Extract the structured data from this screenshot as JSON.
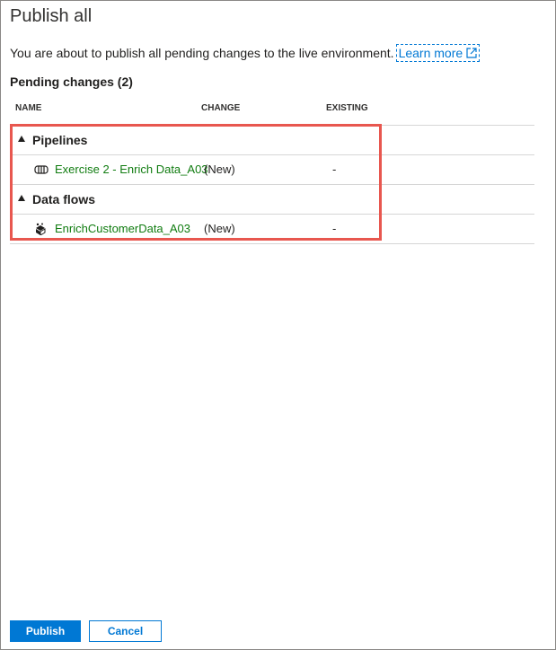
{
  "dialog": {
    "title": "Publish all",
    "description": "You are about to publish all pending changes to the live environment.",
    "learn_more": "Learn more",
    "pending_title": "Pending changes (2)"
  },
  "columns": {
    "name": "NAME",
    "change": "CHANGE",
    "existing": "EXISTING"
  },
  "groups": [
    {
      "label": "Pipelines",
      "icon": "pipeline-icon",
      "items": [
        {
          "name": "Exercise 2 - Enrich Data_A03",
          "change": "(New)",
          "existing": "-"
        }
      ]
    },
    {
      "label": "Data flows",
      "icon": "dataflow-icon",
      "items": [
        {
          "name": "EnrichCustomerData_A03",
          "change": "(New)",
          "existing": "-"
        }
      ]
    }
  ],
  "buttons": {
    "publish": "Publish",
    "cancel": "Cancel"
  },
  "colors": {
    "accent": "#0078d4",
    "link_green": "#107c10",
    "highlight": "#e8574f"
  }
}
